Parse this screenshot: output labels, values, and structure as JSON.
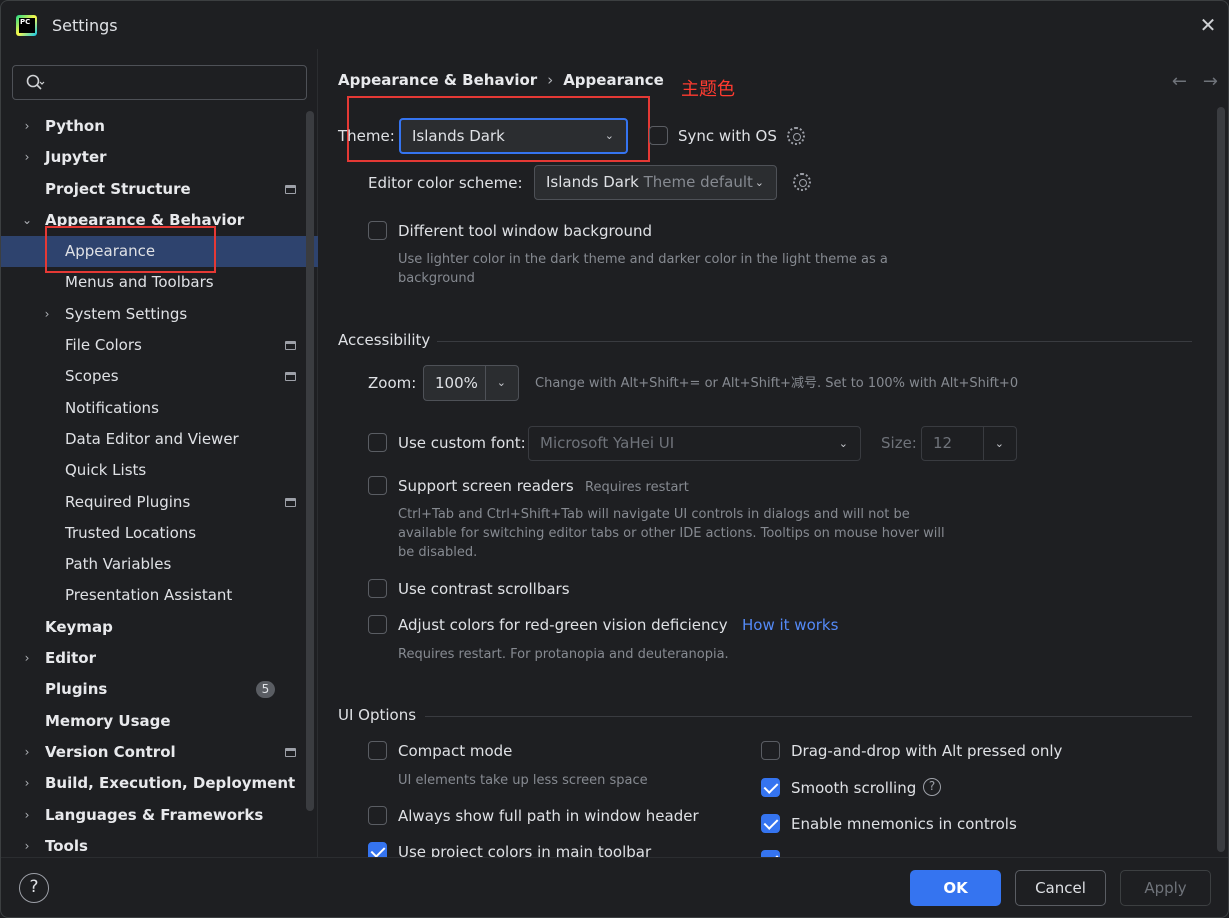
{
  "window": {
    "title": "Settings"
  },
  "search": {
    "placeholder": "",
    "value": ""
  },
  "sidebar": {
    "items": [
      {
        "label": "Python",
        "bold": true,
        "arrow": "›",
        "level": 0
      },
      {
        "label": "Jupyter",
        "bold": true,
        "arrow": "›",
        "level": 0
      },
      {
        "label": "Project Structure",
        "bold": true,
        "arrow": "",
        "level": 0,
        "page_icon": true
      },
      {
        "label": "Appearance & Behavior",
        "bold": true,
        "arrow": "⌄",
        "level": 0
      },
      {
        "label": "Appearance",
        "bold": false,
        "arrow": "",
        "level": 1,
        "selected": true
      },
      {
        "label": "Menus and Toolbars",
        "bold": false,
        "arrow": "",
        "level": 1
      },
      {
        "label": "System Settings",
        "bold": false,
        "arrow": "›",
        "level": 1
      },
      {
        "label": "File Colors",
        "bold": false,
        "arrow": "",
        "level": 1,
        "page_icon": true
      },
      {
        "label": "Scopes",
        "bold": false,
        "arrow": "",
        "level": 1,
        "page_icon": true
      },
      {
        "label": "Notifications",
        "bold": false,
        "arrow": "",
        "level": 1
      },
      {
        "label": "Data Editor and Viewer",
        "bold": false,
        "arrow": "",
        "level": 1
      },
      {
        "label": "Quick Lists",
        "bold": false,
        "arrow": "",
        "level": 1
      },
      {
        "label": "Required Plugins",
        "bold": false,
        "arrow": "",
        "level": 1,
        "page_icon": true
      },
      {
        "label": "Trusted Locations",
        "bold": false,
        "arrow": "",
        "level": 1
      },
      {
        "label": "Path Variables",
        "bold": false,
        "arrow": "",
        "level": 1
      },
      {
        "label": "Presentation Assistant",
        "bold": false,
        "arrow": "",
        "level": 1
      },
      {
        "label": "Keymap",
        "bold": true,
        "arrow": "",
        "level": 0
      },
      {
        "label": "Editor",
        "bold": true,
        "arrow": "›",
        "level": 0
      },
      {
        "label": "Plugins",
        "bold": true,
        "arrow": "",
        "level": 0,
        "badge": "5"
      },
      {
        "label": "Memory Usage",
        "bold": true,
        "arrow": "",
        "level": 0
      },
      {
        "label": "Version Control",
        "bold": true,
        "arrow": "›",
        "level": 0,
        "page_icon": true
      },
      {
        "label": "Build, Execution, Deployment",
        "bold": true,
        "arrow": "›",
        "level": 0
      },
      {
        "label": "Languages & Frameworks",
        "bold": true,
        "arrow": "›",
        "level": 0
      },
      {
        "label": "Tools",
        "bold": true,
        "arrow": "›",
        "level": 0
      }
    ]
  },
  "breadcrumb": {
    "parent": "Appearance & Behavior",
    "separator": "›",
    "current": "Appearance"
  },
  "annotation": {
    "text": "主题色",
    "color": "#e53935"
  },
  "nav": {
    "back": "←",
    "forward": "→"
  },
  "theme": {
    "label": "Theme:",
    "value": "Islands Dark",
    "sync_label": "Sync with OS",
    "sync_checked": false
  },
  "color_scheme": {
    "label": "Editor color scheme:",
    "value": "Islands Dark",
    "suffix": "Theme default"
  },
  "tool_window_bg": {
    "label": "Different tool window background",
    "checked": false,
    "hint_line1": "Use lighter color in the dark theme and darker color in the light theme as a",
    "hint_line2": "background"
  },
  "accessibility": {
    "title": "Accessibility",
    "zoom_label": "Zoom:",
    "zoom_value": "100%",
    "zoom_hint": "Change with Alt+Shift+= or Alt+Shift+减号. Set to 100% with Alt+Shift+0",
    "custom_font_label": "Use custom font:",
    "custom_font_checked": false,
    "custom_font_value": "Microsoft YaHei UI",
    "size_label": "Size:",
    "size_value": "12",
    "screen_readers_label": "Support screen readers",
    "screen_readers_checked": false,
    "screen_readers_note": "Requires restart",
    "screen_readers_hint_1": "Ctrl+Tab and Ctrl+Shift+Tab will navigate UI controls in dialogs and will not be",
    "screen_readers_hint_2": "available for switching editor tabs or other IDE actions. Tooltips on mouse hover will",
    "screen_readers_hint_3": "be disabled.",
    "contrast_label": "Use contrast scrollbars",
    "contrast_checked": false,
    "red_green_label": "Adjust colors for red-green vision deficiency",
    "red_green_checked": false,
    "how_it_works": "How it works",
    "red_green_hint": "Requires restart. For protanopia and deuteranopia."
  },
  "ui_options": {
    "title": "UI Options",
    "compact_label": "Compact mode",
    "compact_checked": false,
    "compact_hint": "UI elements take up less screen space",
    "full_path_label": "Always show full path in window header",
    "full_path_checked": false,
    "project_colors_label": "Use project colors in main toolbar",
    "project_colors_checked": true,
    "drag_drop_label": "Drag-and-drop with Alt pressed only",
    "drag_drop_checked": false,
    "smooth_label": "Smooth scrolling",
    "smooth_checked": true,
    "smooth_help": "?",
    "mnemonics_label": "Enable mnemonics in controls",
    "mnemonics_checked": true,
    "next_checked": true
  },
  "footer": {
    "help": "?",
    "ok": "OK",
    "cancel": "Cancel",
    "apply": "Apply"
  },
  "colors": {
    "accent": "#3574f0",
    "selection": "#2e436e",
    "link": "#548af7",
    "background": "#1e1f22"
  }
}
